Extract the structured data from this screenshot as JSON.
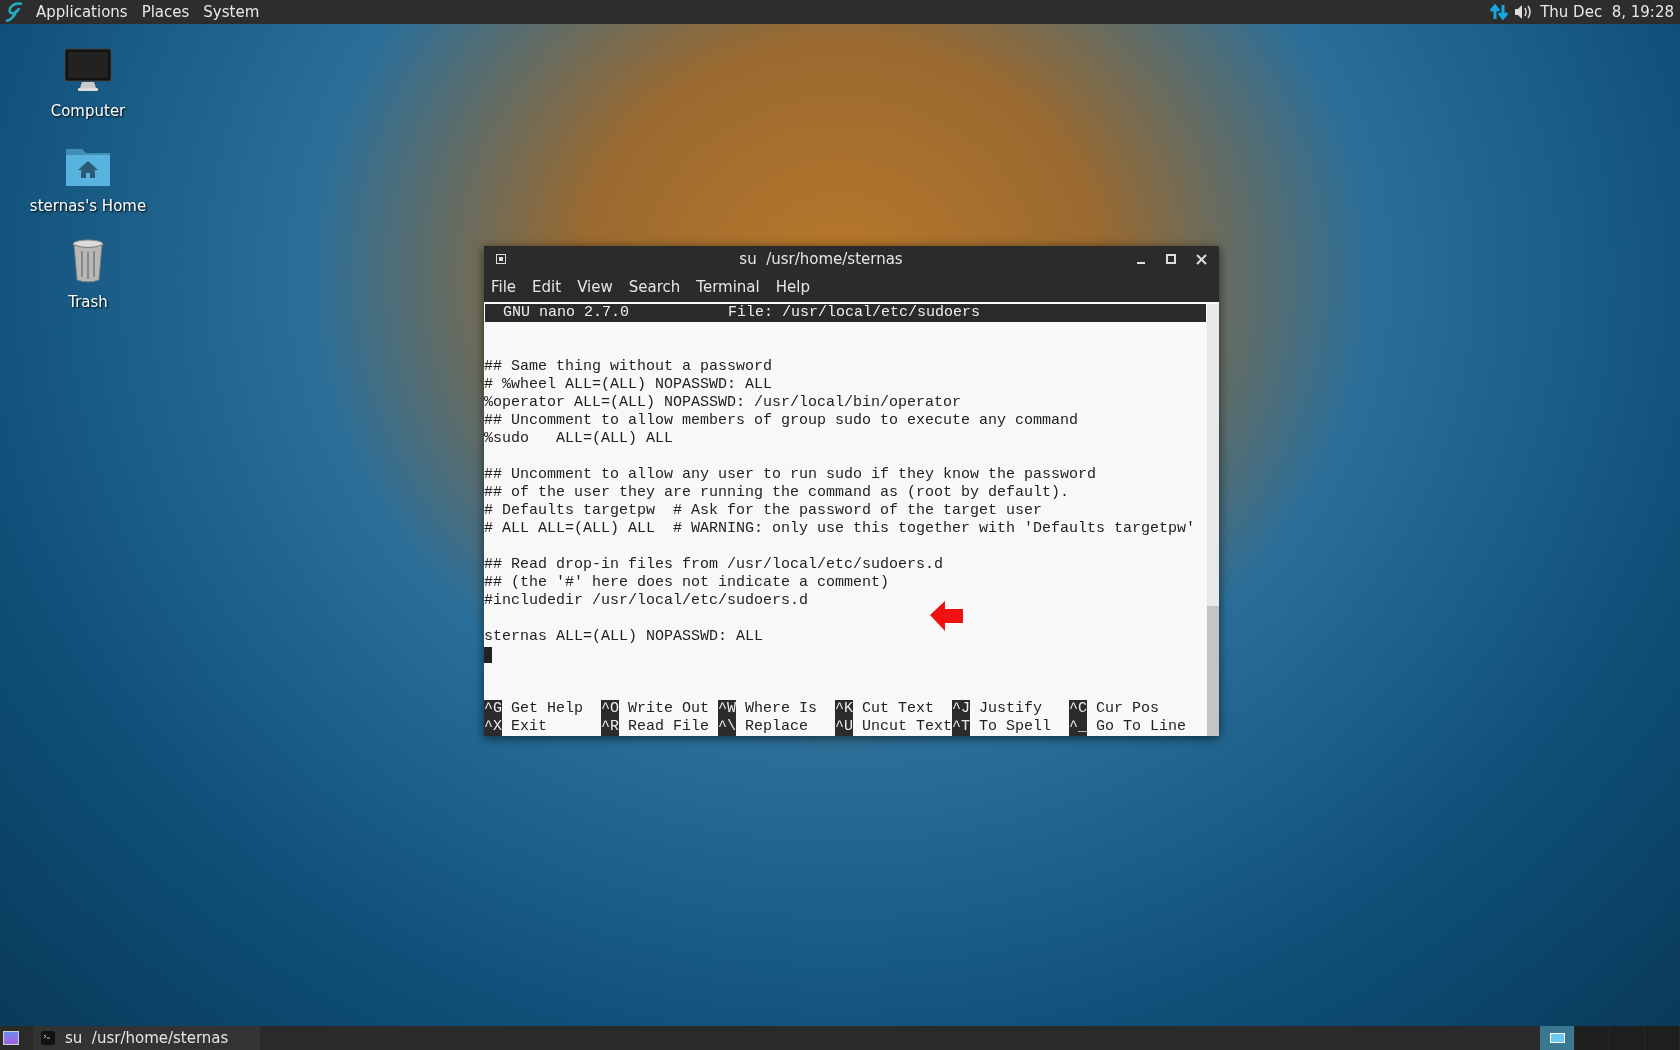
{
  "top_panel": {
    "menus": [
      "Applications",
      "Places",
      "System"
    ],
    "clock": "Thu Dec  8, 19:28"
  },
  "desktop_icons": [
    {
      "kind": "computer",
      "label": "Computer"
    },
    {
      "kind": "home",
      "label": "sternas's Home"
    },
    {
      "kind": "trash",
      "label": "Trash"
    }
  ],
  "window": {
    "title": "su  /usr/home/sternas",
    "menu": [
      "File",
      "Edit",
      "View",
      "Search",
      "Terminal",
      "Help"
    ],
    "editor": {
      "version": "GNU nano 2.7.0",
      "file": "File: /usr/local/etc/sudoers",
      "blocks": [
        [
          "## Same thing without a password",
          "# %wheel ALL=(ALL) NOPASSWD: ALL",
          "%operator ALL=(ALL) NOPASSWD: /usr/local/bin/operator",
          "## Uncomment to allow members of group sudo to execute any command",
          "%sudo   ALL=(ALL) ALL"
        ],
        [
          "## Uncomment to allow any user to run sudo if they know the password",
          "## of the user they are running the command as (root by default).",
          "# Defaults targetpw  # Ask for the password of the target user",
          "# ALL ALL=(ALL) ALL  # WARNING: only use this together with 'Defaults targetpw'"
        ],
        [
          "## Read drop-in files from /usr/local/etc/sudoers.d",
          "## (the '#' here does not indicate a comment)",
          "#includedir /usr/local/etc/sudoers.d"
        ],
        [
          "sternas ALL=(ALL) NOPASSWD: ALL"
        ]
      ],
      "shortcuts": [
        [
          {
            "key": "^G",
            "label": "Get Help"
          },
          {
            "key": "^O",
            "label": "Write Out"
          },
          {
            "key": "^W",
            "label": "Where Is"
          },
          {
            "key": "^K",
            "label": "Cut Text"
          },
          {
            "key": "^J",
            "label": "Justify"
          },
          {
            "key": "^C",
            "label": "Cur Pos"
          }
        ],
        [
          {
            "key": "^X",
            "label": "Exit"
          },
          {
            "key": "^R",
            "label": "Read File"
          },
          {
            "key": "^\\",
            "label": "Replace"
          },
          {
            "key": "^U",
            "label": "Uncut Text"
          },
          {
            "key": "^T",
            "label": "To Spell"
          },
          {
            "key": "^_",
            "label": "Go To Line"
          }
        ]
      ]
    }
  },
  "taskbar": {
    "tasks": [
      {
        "label": "su  /usr/home/sternas"
      }
    ],
    "workspaces": [
      {
        "selected": true
      },
      {
        "selected": false
      },
      {
        "selected": false
      },
      {
        "selected": false
      }
    ]
  }
}
